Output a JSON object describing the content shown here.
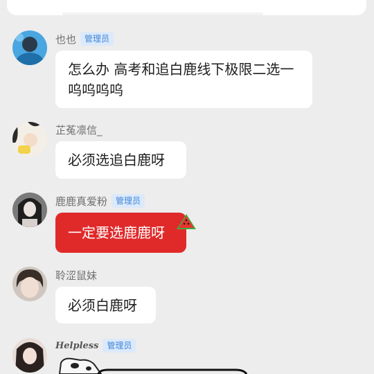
{
  "messages": [
    {
      "user": "也也",
      "role": "管理员",
      "text": "怎么办 高考和追白鹿线下极限二选一呜呜呜呜"
    },
    {
      "user": "芷菟凛信_",
      "role": "",
      "text": "必须选追白鹿呀"
    },
    {
      "user": "鹿鹿真爱粉",
      "role": "管理员",
      "text": "一定要选鹿鹿呀"
    },
    {
      "user": "聆涩鼠妹",
      "role": "",
      "text": "必须白鹿呀"
    },
    {
      "user": "Helpless",
      "role": "管理员",
      "text": ""
    }
  ],
  "colors": {
    "background": "#ededed",
    "bubble": "#ffffff",
    "bubble_highlight": "#e02a2a",
    "badge_text": "#3f86d6",
    "badge_bg": "#dbe9fb"
  },
  "icons": [
    "watermelon-icon",
    "cow-sticker-icon"
  ]
}
